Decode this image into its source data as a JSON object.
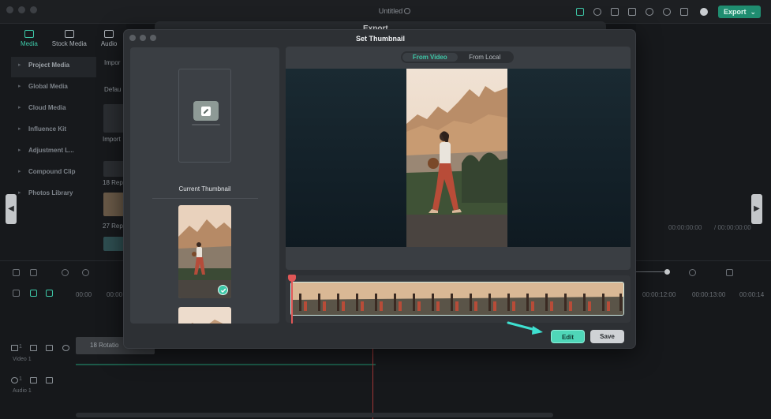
{
  "app": {
    "title": "Untitled",
    "export_label": "Export",
    "export_caret": "⌄",
    "accent_color": "#3ec8a8",
    "background_dialog_title": "Export"
  },
  "media_tabs": [
    {
      "label": "Media",
      "icon": "media-icon",
      "active": true
    },
    {
      "label": "Stock Media",
      "icon": "stock-media-icon",
      "active": false
    },
    {
      "label": "Audio",
      "icon": "audio-icon",
      "active": false
    }
  ],
  "sidebar": {
    "items": [
      {
        "label": "Project Media",
        "active": true
      },
      {
        "label": "Global Media"
      },
      {
        "label": "Cloud Media"
      },
      {
        "label": "Influence Kit"
      },
      {
        "label": "Adjustment L..."
      },
      {
        "label": "Compound Clip"
      },
      {
        "label": "Photos Library"
      }
    ]
  },
  "media_bin_fragments": {
    "import_button": "Impor",
    "sort_dropdown": "Defau",
    "import_label": "Import",
    "item_1": "18 Rep",
    "item_2": "27 Rep"
  },
  "right_panel": {
    "timecode": "00:00:00:00",
    "duration": "/ 00:00:00:00"
  },
  "timeline": {
    "ruler": [
      "00:00",
      "00:00",
      "00:00:12:00",
      "00:00:13:00",
      "00:00:14"
    ],
    "tracks": [
      {
        "label": "Video 1",
        "number": "1"
      },
      {
        "label": "Audio 1",
        "number": "1"
      }
    ],
    "clip_label": "18 Rotatio"
  },
  "modal": {
    "title": "Set Thumbnail",
    "current_thumbnail_label": "Current Thumbnail",
    "source_tabs": [
      {
        "label": "From Video",
        "active": true
      },
      {
        "label": "From Local",
        "active": false
      }
    ],
    "edit_button": "Edit",
    "save_button": "Save",
    "selected_frame_checked": true
  }
}
